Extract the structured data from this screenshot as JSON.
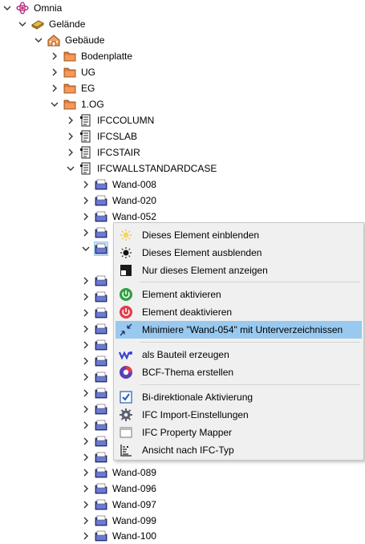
{
  "tree": {
    "root": "Omnia",
    "site": "Gelände",
    "building": "Gebäude",
    "storeys": [
      "Bodenplatte",
      "UG",
      "EG",
      "1.OG"
    ],
    "types": [
      "IFCCOLUMN",
      "IFCSLAB",
      "IFCSTAIR",
      "IFCWALLSTANDARDCASE"
    ],
    "walls_top": [
      "Wand-008",
      "Wand-020",
      "Wand-052"
    ],
    "walls_bottom": [
      "Wand-089",
      "Wand-096",
      "Wand-097",
      "Wand-099",
      "Wand-100"
    ]
  },
  "menu": {
    "items": [
      "Dieses Element einblenden",
      "Dieses Element ausblenden",
      "Nur dieses Element anzeigen",
      "Element aktivieren",
      "Element deaktivieren",
      "Minimiere \"Wand-054\" mit Unterverzeichnissen",
      "als Bauteil erzeugen",
      "BCF-Thema erstellen",
      "Bi-direktionale Aktivierung",
      "IFC Import-Einstellungen",
      "IFC Property Mapper",
      "Ansicht nach IFC-Typ"
    ]
  },
  "colors": {
    "highlight": "#99c9ef",
    "folder": "#e07b39",
    "wall_folder": "#2f3d8f"
  }
}
